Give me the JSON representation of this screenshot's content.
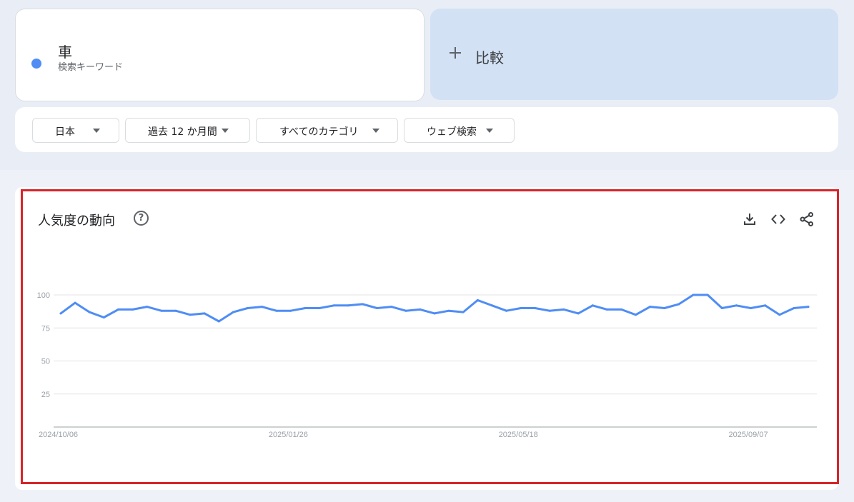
{
  "search_term": {
    "name": "車",
    "subtitle": "検索キーワード",
    "color": "#4f8df5"
  },
  "compare": {
    "label": "比較",
    "icon": "plus-icon"
  },
  "filters": [
    {
      "label": "日本",
      "icon": "caret-down-icon"
    },
    {
      "label": "過去 12 か月間",
      "icon": "caret-down-icon"
    },
    {
      "label": "すべてのカテゴリ",
      "icon": "caret-down-icon"
    },
    {
      "label": "ウェブ検索",
      "icon": "caret-down-icon"
    }
  ],
  "panel": {
    "title": "人気度の動向",
    "help_icon": "help-circle-icon",
    "help_glyph": "?",
    "actions": [
      "download-icon",
      "embed-code-icon",
      "share-icon"
    ],
    "highlight_color": "#d9232a"
  },
  "chart_data": {
    "type": "line",
    "title": "",
    "xlabel": "",
    "ylabel": "",
    "ylim": [
      0,
      100
    ],
    "y_ticks": [
      "100",
      "75",
      "50",
      "25"
    ],
    "y_tick_values": [
      100,
      75,
      50,
      25
    ],
    "x_tick_labels": [
      "2024/10/06",
      "2025/01/26",
      "2025/05/18",
      "2025/09/07"
    ],
    "x_tick_index": [
      0,
      16,
      32,
      48
    ],
    "grid": true,
    "line_color": "#4f8df5",
    "series": [
      {
        "values": [
          86,
          94,
          87,
          83,
          89,
          89,
          91,
          88,
          88,
          85,
          86,
          80,
          87,
          90,
          91,
          88,
          88,
          90,
          90,
          92,
          92,
          93,
          90,
          91,
          88,
          89,
          86,
          88,
          87,
          96,
          92,
          88,
          90,
          90,
          88,
          89,
          86,
          92,
          89,
          89,
          85,
          91,
          90,
          93,
          100,
          100,
          90,
          92,
          90,
          92,
          85,
          90,
          91
        ]
      }
    ]
  }
}
